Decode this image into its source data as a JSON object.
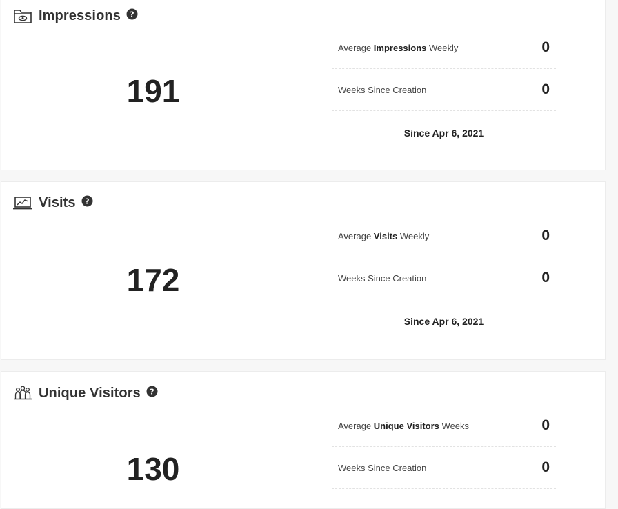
{
  "cards": [
    {
      "icon": "folder-eye-icon",
      "title": "Impressions",
      "total": "191",
      "avg_prefix": "Average ",
      "avg_metric": "Impressions",
      "avg_suffix": " Weekly",
      "avg_value": "0",
      "weeks_label": "Weeks Since Creation",
      "weeks_value": "0",
      "since": "Since Apr 6, 2021"
    },
    {
      "icon": "laptop-chart-icon",
      "title": "Visits",
      "total": "172",
      "avg_prefix": "Average ",
      "avg_metric": "Visits",
      "avg_suffix": " Weekly",
      "avg_value": "0",
      "weeks_label": "Weeks Since Creation",
      "weeks_value": "0",
      "since": "Since Apr 6, 2021"
    },
    {
      "icon": "people-group-icon",
      "title": "Unique Visitors",
      "total": "130",
      "avg_prefix": "Average ",
      "avg_metric": "Unique Visitors",
      "avg_suffix": " Weeks",
      "avg_value": "0",
      "weeks_label": "Weeks Since Creation",
      "weeks_value": "0"
    }
  ]
}
